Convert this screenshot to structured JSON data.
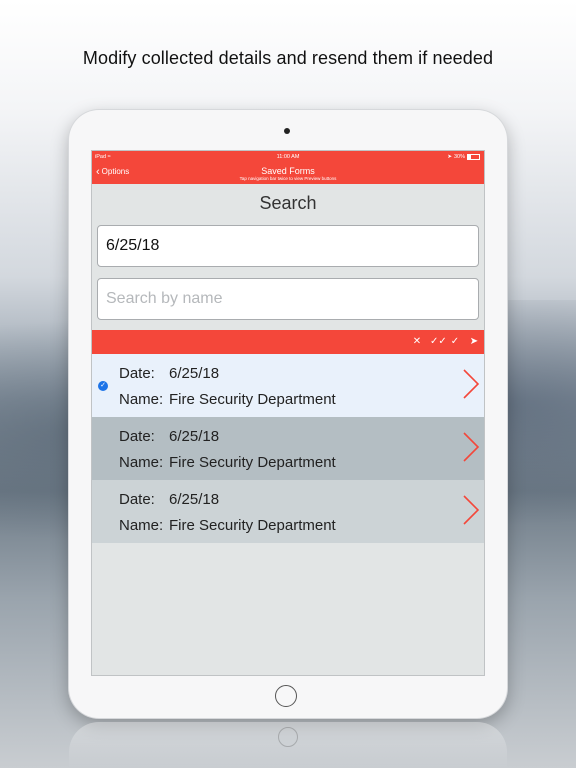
{
  "headline": "Modify collected details and resend them if needed",
  "status_bar": {
    "carrier": "iPad",
    "wifi_icon": "wifi-icon",
    "time": "11:00 AM",
    "battery_percent": "30%",
    "battery_level": 0.3
  },
  "nav": {
    "back_label": "Options",
    "title": "Saved Forms",
    "subtitle": "Tap navigation bar twice to view Preview buttons"
  },
  "search": {
    "heading": "Search",
    "date_value": "6/25/18",
    "name_placeholder": "Search by name"
  },
  "toolbar": {
    "icons": [
      "close-icon",
      "double-check-icon",
      "check-user-icon",
      "send-icon"
    ]
  },
  "forms": [
    {
      "date_label": "Date:",
      "date": "6/25/18",
      "name_label": "Name:",
      "name": "Fire Security Department",
      "selected": true
    },
    {
      "date_label": "Date:",
      "date": "6/25/18",
      "name_label": "Name:",
      "name": "Fire Security Department",
      "selected": false
    },
    {
      "date_label": "Date:",
      "date": "6/25/18",
      "name_label": "Name:",
      "name": "Fire Security Department",
      "selected": false
    }
  ],
  "colors": {
    "accent": "#f4473a",
    "selected_row": "#e9f1fb",
    "check": "#1d74e8"
  }
}
